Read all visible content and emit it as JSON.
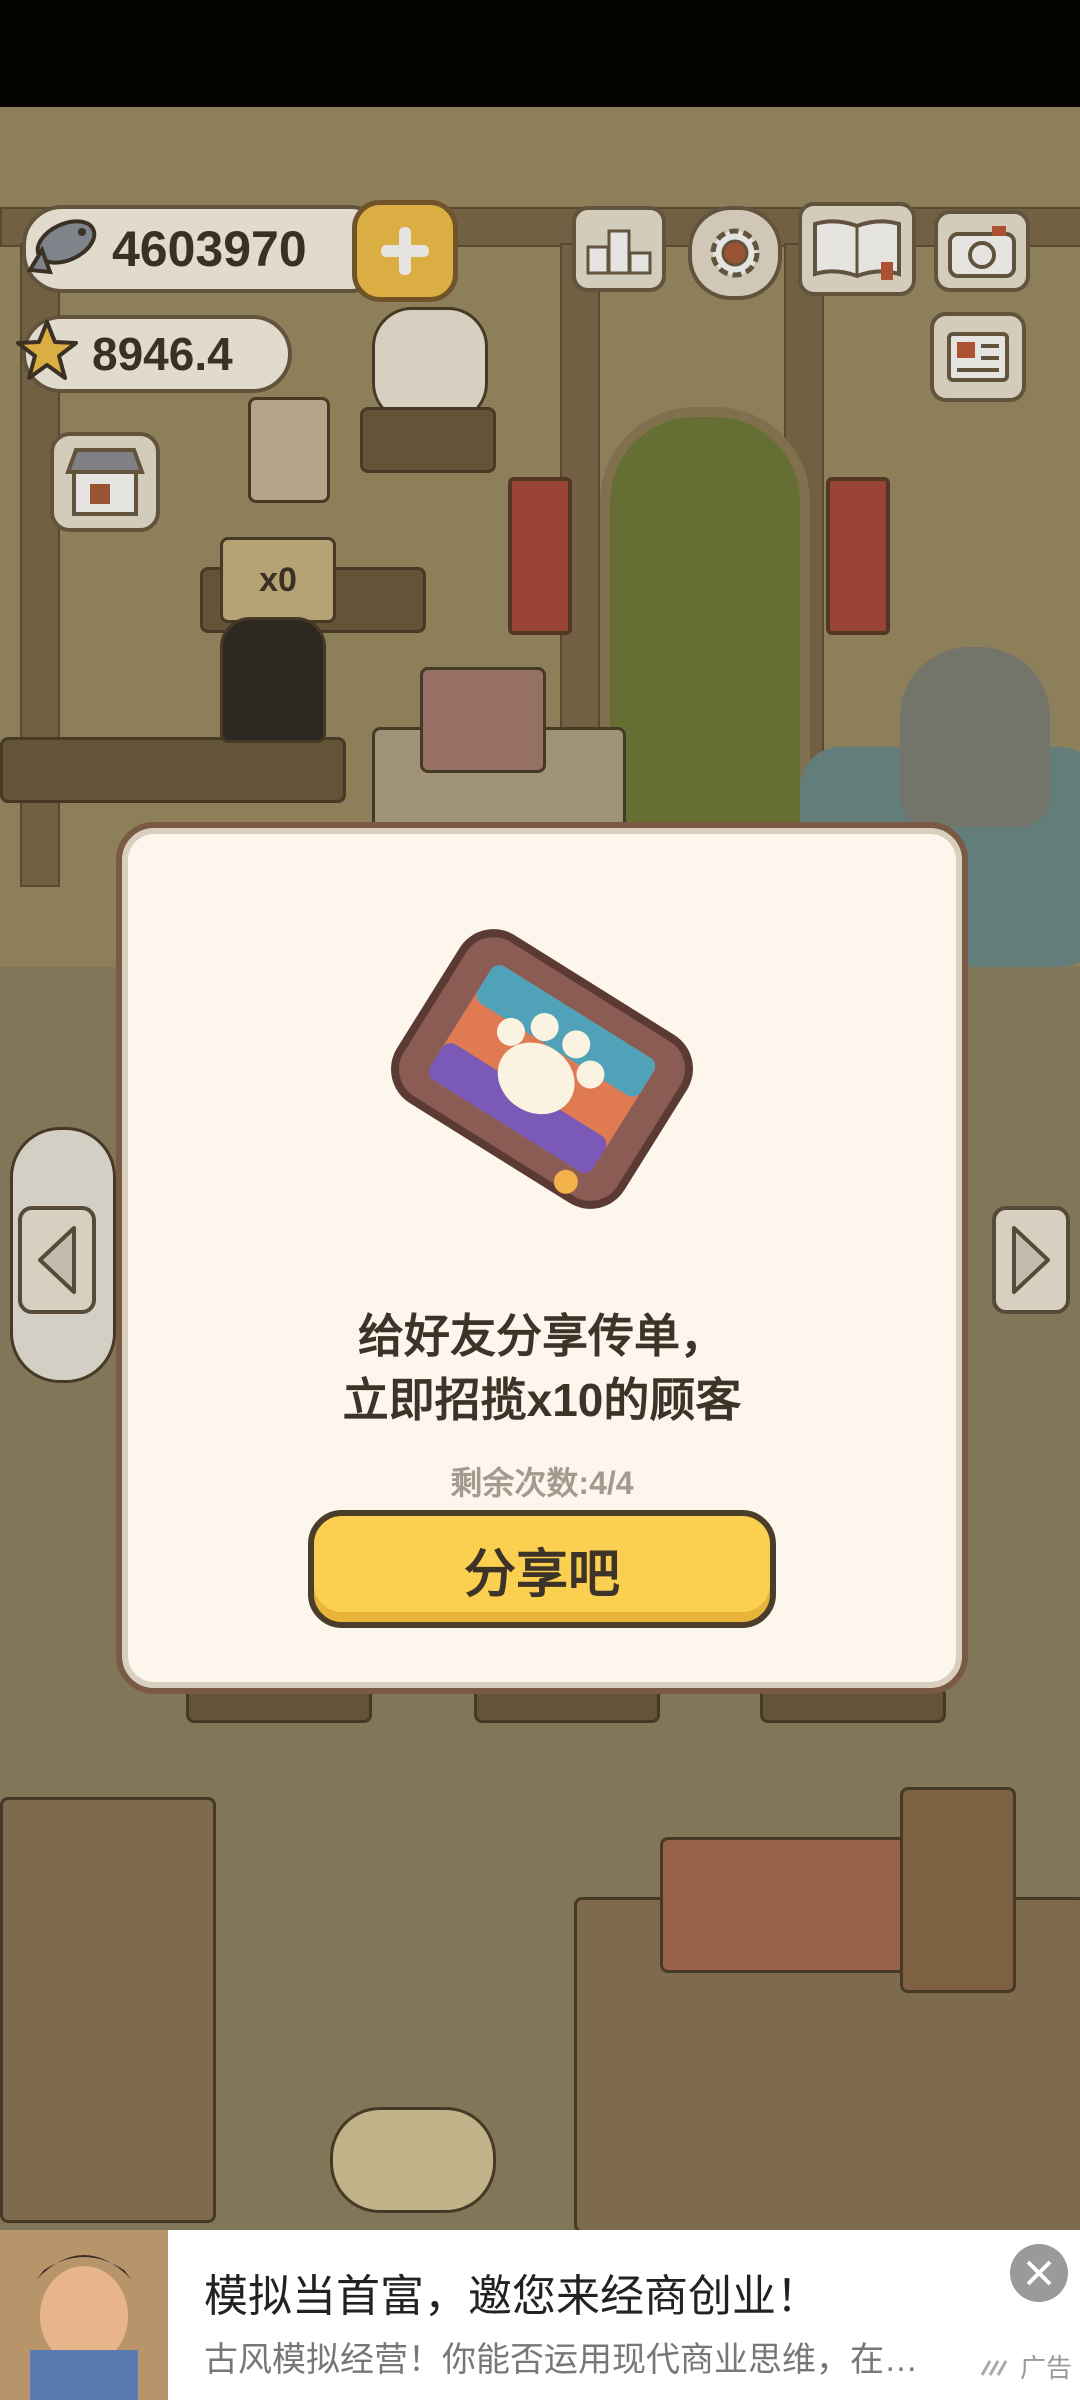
{
  "hud": {
    "fish_count": "4603970",
    "star_count": "8946.4",
    "icons": [
      "fish-icon",
      "star-icon",
      "plus-icon",
      "ranking-icon",
      "settings-gear-icon",
      "recipe-book-icon",
      "camera-icon",
      "menu-board-icon",
      "shop-icon"
    ]
  },
  "scene": {
    "sign_text": "x0"
  },
  "modal": {
    "line1": "给好友分享传单，",
    "line2": "立即招揽x10的顾客",
    "remaining": "剩余次数:4/4",
    "share_button": "分享吧",
    "icon": "flyer-paw-icon"
  },
  "ad": {
    "title": "模拟当首富，邀您来经商创业！",
    "subtitle": "古风模拟经营！你能否运用现代商业思维，在当下开创一番事业",
    "label": "广告"
  },
  "colors": {
    "accent_yellow": "#fbd050",
    "modal_bg": "#fcf6ec",
    "outline": "#4a3d2a"
  }
}
